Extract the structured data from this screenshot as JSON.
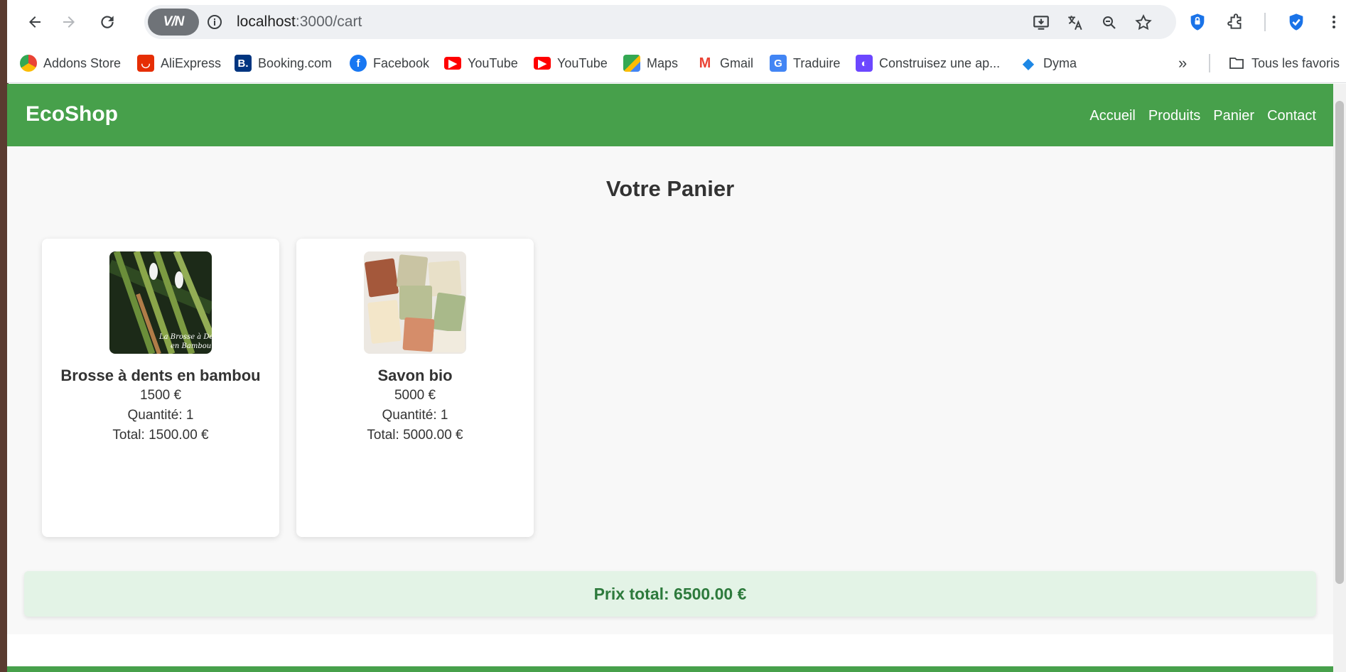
{
  "browser": {
    "vpn_label": "V/N",
    "url_host": "localhost",
    "url_path": ":3000/cart",
    "bookmarks": [
      {
        "label": "Addons Store",
        "color": "#ea4335"
      },
      {
        "label": "AliExpress",
        "color": "#e62e04"
      },
      {
        "label": "Booking.com",
        "color": "#003580"
      },
      {
        "label": "Facebook",
        "color": "#1877f2"
      },
      {
        "label": "YouTube",
        "color": "#ff0000"
      },
      {
        "label": "YouTube",
        "color": "#ff0000"
      },
      {
        "label": "Maps",
        "color": "#34a853"
      },
      {
        "label": "Gmail",
        "color": "#ea4335"
      },
      {
        "label": "Traduire",
        "color": "#4285f4"
      },
      {
        "label": "Construisez une ap...",
        "color": "#6c47ff"
      },
      {
        "label": "Dyma",
        "color": "#1e88e5"
      }
    ],
    "all_bookmarks_label": "Tous les favoris"
  },
  "site": {
    "logo": "EcoShop",
    "nav": [
      "Accueil",
      "Produits",
      "Panier",
      "Contact"
    ],
    "brand_color": "#47a04b"
  },
  "cart": {
    "title": "Votre Panier",
    "items": [
      {
        "name": "Brosse à dents en bambou",
        "price": "1500 €",
        "quantity": "Quantité: 1",
        "total": "Total: 1500.00 €",
        "image_caption": "La Brosse à Dents en Bambou"
      },
      {
        "name": "Savon bio",
        "price": "5000 €",
        "quantity": "Quantité: 1",
        "total": "Total: 5000.00 €"
      }
    ],
    "grand_total": "Prix total: 6500.00 €"
  }
}
